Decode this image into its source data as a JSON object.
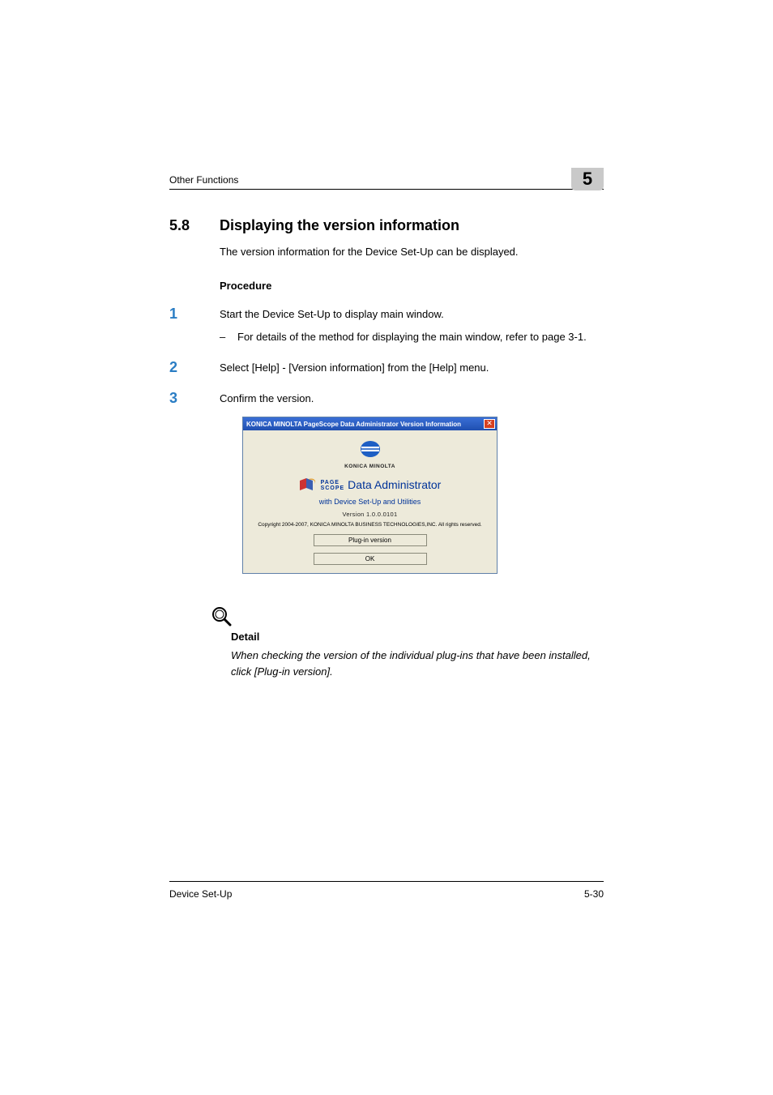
{
  "header": {
    "text": "Other Functions",
    "chapter": "5"
  },
  "section": {
    "num": "5.8",
    "title": "Displaying the version information",
    "intro": "The version information for the Device Set-Up can be displayed."
  },
  "procedure_label": "Procedure",
  "steps": [
    {
      "num": "1",
      "text": "Start the Device Set-Up to display main window.",
      "sub": "For details of the method for displaying the main window, refer to page 3-1."
    },
    {
      "num": "2",
      "text": "Select [Help] - [Version information] from the [Help] menu."
    },
    {
      "num": "3",
      "text": "Confirm the version."
    }
  ],
  "dialog": {
    "title": "KONICA MINOLTA PageScope Data Administrator Version Information",
    "close_glyph": "✕",
    "brand": "KONICA MINOLTA",
    "ps_page": "PAGE",
    "ps_scope": "SCOPE",
    "ps_admin": "Data Administrator",
    "ps_sub": "with Device Set-Up and Utilities",
    "version": "Version 1.0.0.0101",
    "copyright": "Copyright 2004-2007, KONICA MINOLTA BUSINESS TECHNOLOGIES,INC. All rights reserved.",
    "btn_plugin": "Plug-in version",
    "btn_ok": "OK"
  },
  "detail": {
    "title": "Detail",
    "body": "When checking the version of the individual plug-ins that have been installed, click [Plug-in version]."
  },
  "footer": {
    "left": "Device Set-Up",
    "right": "5-30"
  }
}
